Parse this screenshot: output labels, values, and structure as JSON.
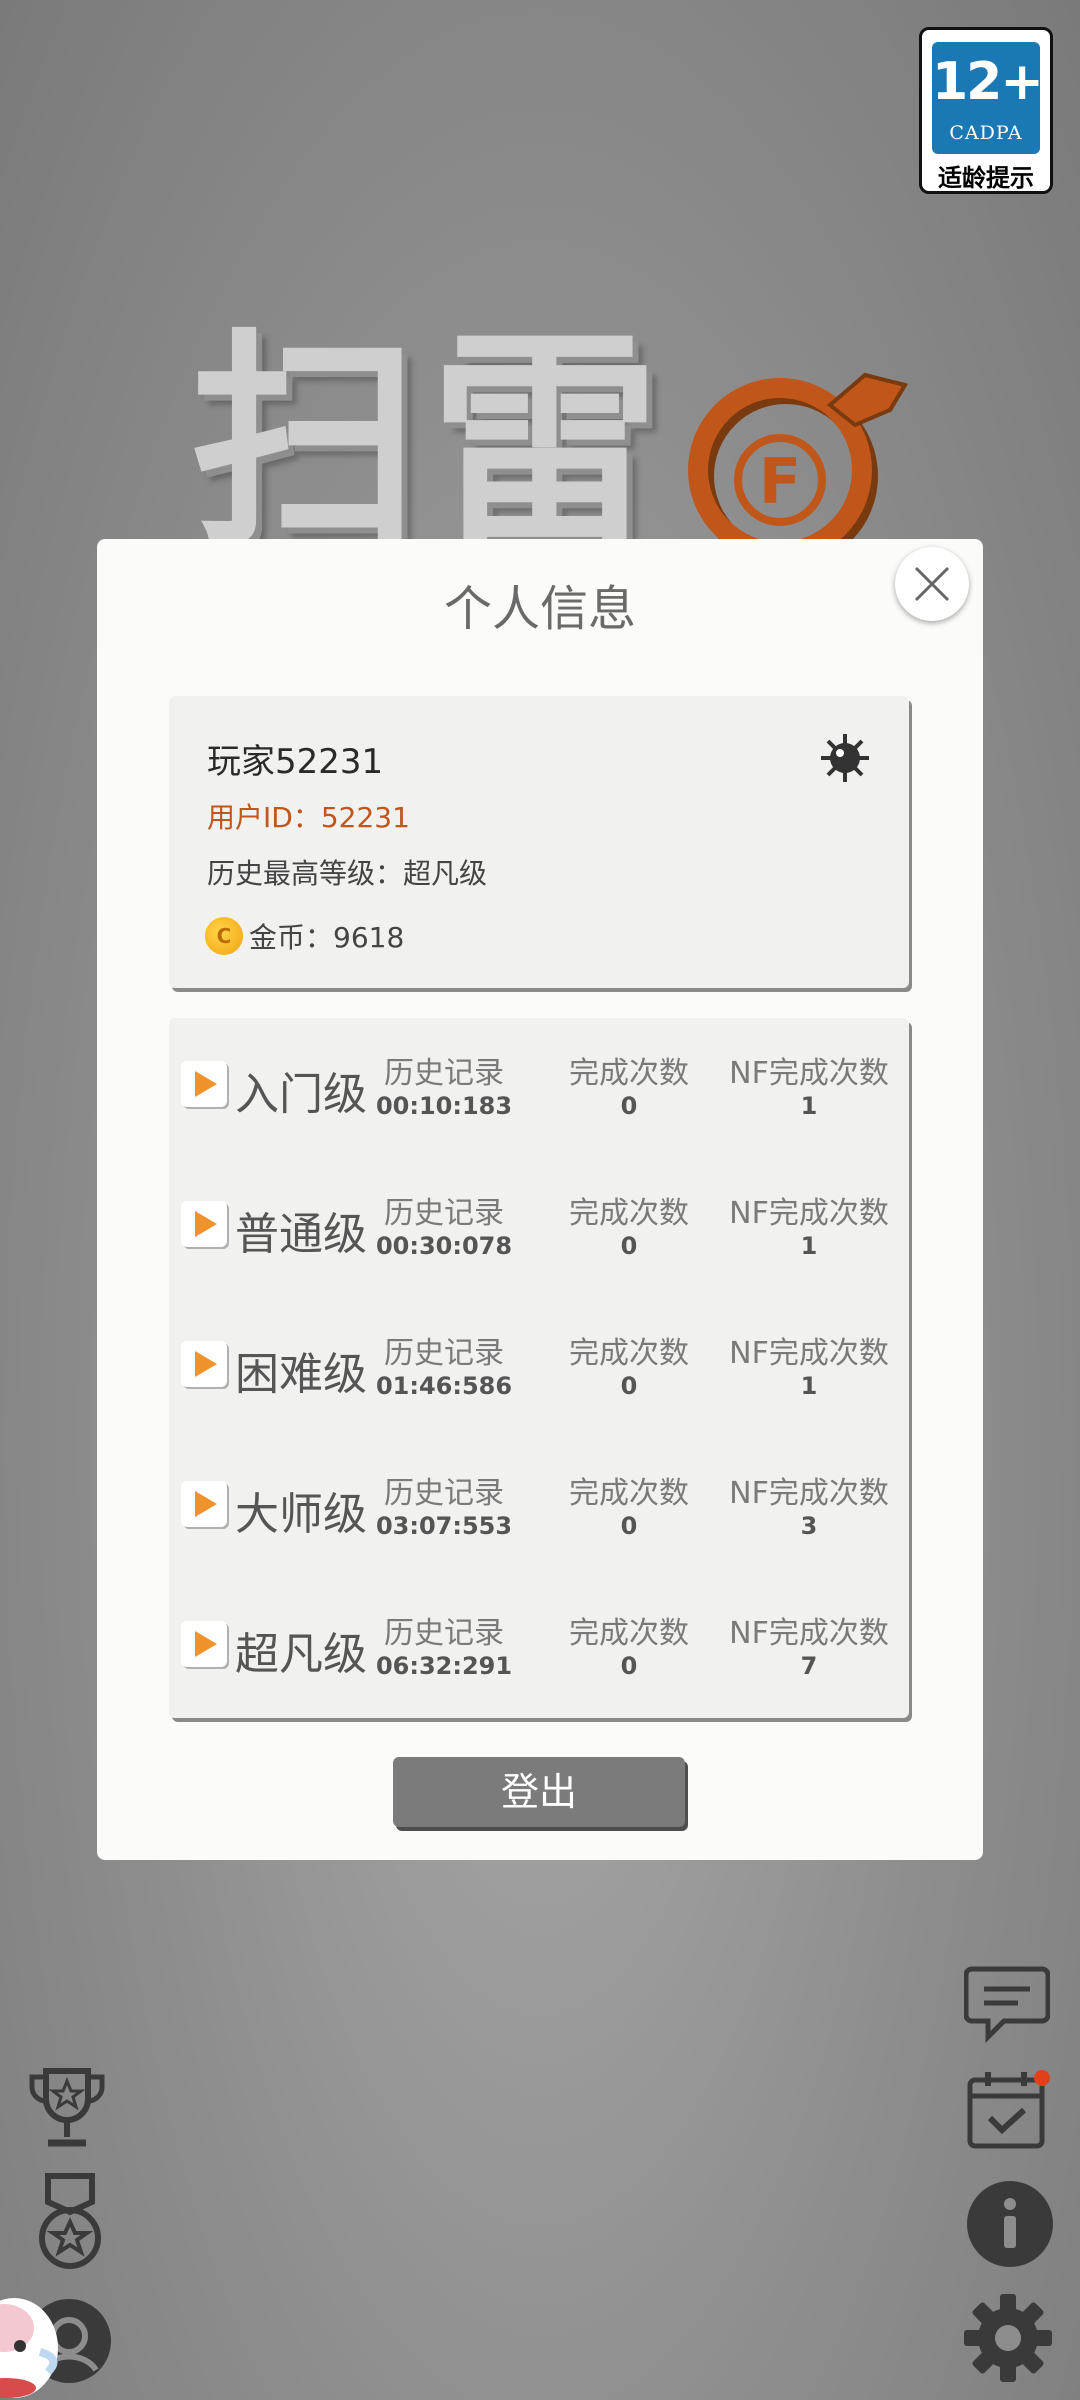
{
  "age_badge": {
    "age": "12+",
    "org": "CADPA",
    "tip": "适龄提示"
  },
  "logo": {
    "text": "扫雷",
    "letter": "F",
    "accent_color": "#c0561a"
  },
  "dialog": {
    "title": "个人信息",
    "player_name": "玩家52231",
    "user_id": "用户ID：52231",
    "best_level": "历史最高等级：超凡级",
    "coins": "金币：9618",
    "coin_symbol": "C",
    "logout_label": "登出",
    "records": [
      {
        "level": "入门级",
        "record_label": "历史记录",
        "record": "00:10:183",
        "complete_label": "完成次数",
        "complete": "0",
        "nf_label": "NF完成次数",
        "nf": "1"
      },
      {
        "level": "普通级",
        "record_label": "历史记录",
        "record": "00:30:078",
        "complete_label": "完成次数",
        "complete": "0",
        "nf_label": "NF完成次数",
        "nf": "1"
      },
      {
        "level": "困难级",
        "record_label": "历史记录",
        "record": "01:46:586",
        "complete_label": "完成次数",
        "complete": "0",
        "nf_label": "NF完成次数",
        "nf": "1"
      },
      {
        "level": "大师级",
        "record_label": "历史记录",
        "record": "03:07:553",
        "complete_label": "完成次数",
        "complete": "0",
        "nf_label": "NF完成次数",
        "nf": "3"
      },
      {
        "level": "超凡级",
        "record_label": "历史记录",
        "record": "06:32:291",
        "complete_label": "完成次数",
        "complete": "0",
        "nf_label": "NF完成次数",
        "nf": "7"
      }
    ]
  },
  "icons": {
    "left": [
      "trophy-icon",
      "medal-icon",
      "avatar-icon"
    ],
    "right": [
      "chat-icon",
      "calendar-check-icon",
      "info-icon",
      "gear-icon"
    ],
    "notification_dot_color": "#e0401a"
  }
}
